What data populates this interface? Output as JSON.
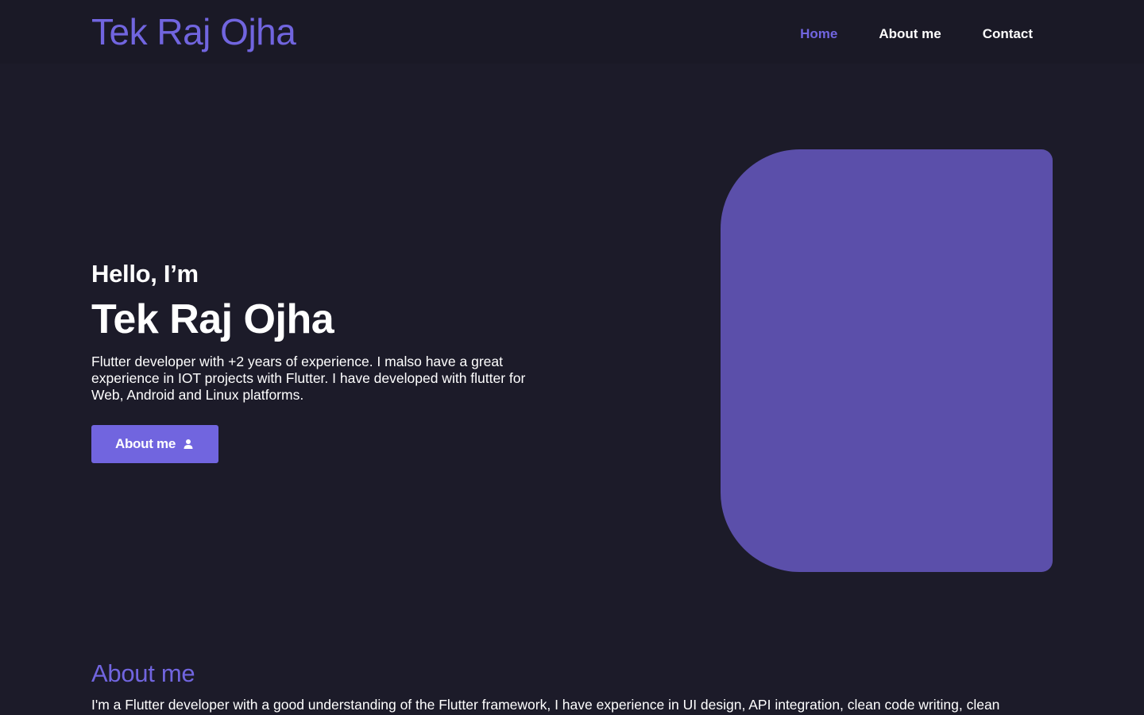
{
  "header": {
    "brand": "Tek Raj Ojha",
    "nav": [
      {
        "label": "Home",
        "active": true
      },
      {
        "label": "About me",
        "active": false
      },
      {
        "label": "Contact",
        "active": false
      }
    ]
  },
  "hero": {
    "greeting": "Hello, I’m",
    "name": "Tek Raj Ojha",
    "description": "Flutter developer with +2 years of experience. I malso have a great experience in IOT projects with Flutter. I have developed with flutter for Web, Android and Linux platforms.",
    "button_label": "About me",
    "button_icon": "person-icon"
  },
  "about": {
    "title": "About me",
    "text": "I'm a Flutter developer with a good understanding of the Flutter framework, I have experience in UI design, API integration, clean code writing, clean"
  },
  "colors": {
    "background": "#1c1b29",
    "header_background": "#1a1926",
    "accent": "#7165df",
    "image_placeholder": "#5b4faa",
    "text": "#ffffff"
  }
}
